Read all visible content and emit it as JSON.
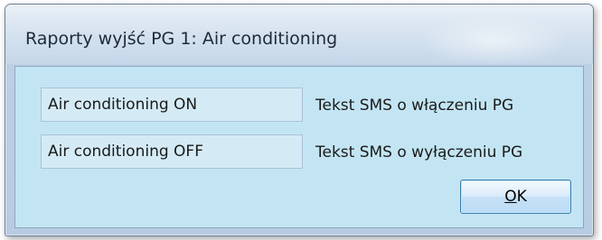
{
  "window": {
    "title": "Raporty wyjść PG 1: Air conditioning"
  },
  "outputs": [
    {
      "value": "Air conditioning ON",
      "label": "Tekst SMS o włączeniu PG"
    },
    {
      "value": "Air conditioning OFF",
      "label": "Tekst SMS o wyłączeniu PG"
    }
  ],
  "buttons": {
    "ok_mnemonic": "O",
    "ok_rest": "K"
  }
}
